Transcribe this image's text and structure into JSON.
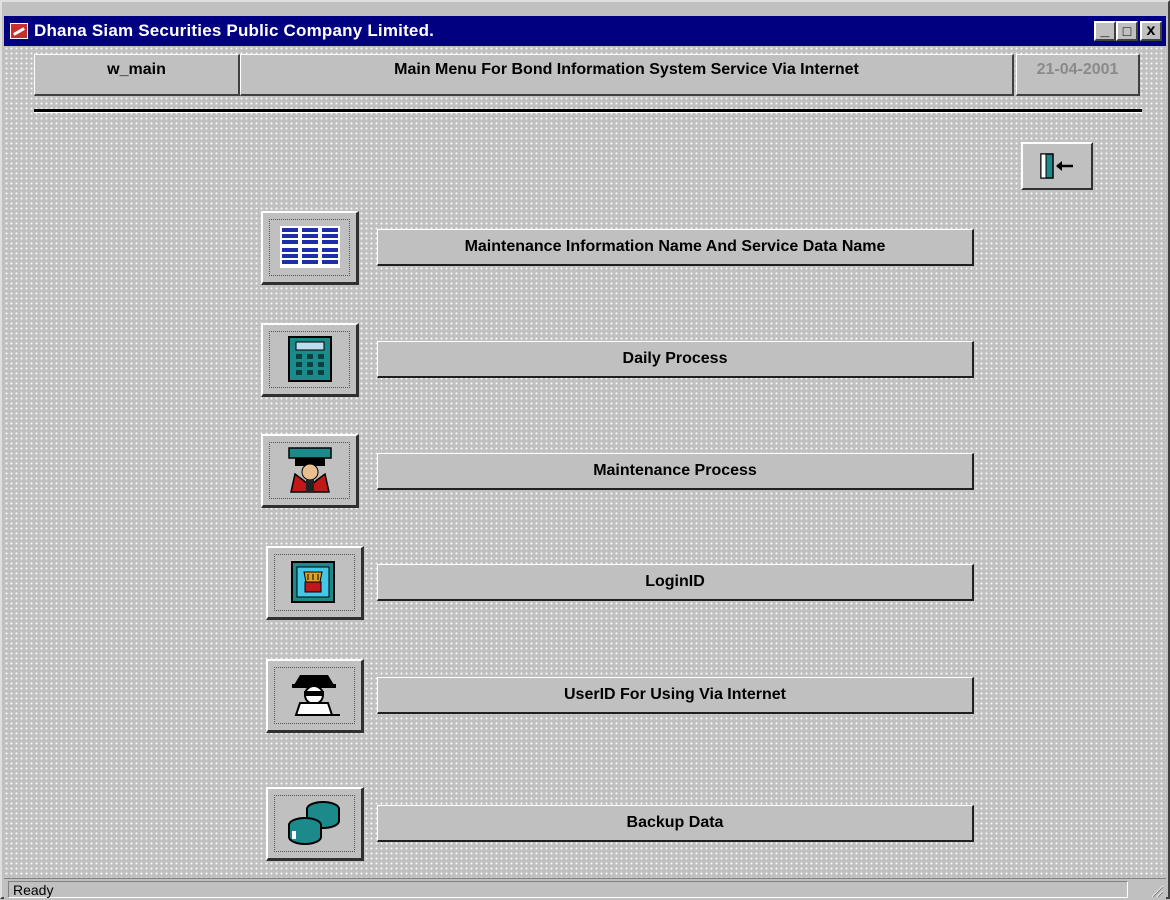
{
  "window": {
    "title": "Dhana Siam Securities Public Company Limited.",
    "app_icon": "app-icon",
    "controls": {
      "minimize": "_",
      "maximize": "□",
      "close": "x"
    }
  },
  "header": {
    "window_name": "w_main",
    "title": "Main Menu For Bond Information System Service Via Internet",
    "date": "21-04-2001"
  },
  "toolbar": {
    "exit_icon": "exit-door-icon"
  },
  "menu": [
    {
      "label": "Maintenance Information Name And Service Data Name",
      "icon": "grid-list-icon"
    },
    {
      "label": "Daily Process",
      "icon": "calculator-icon"
    },
    {
      "label": "Maintenance Process",
      "icon": "maintenance-worker-icon"
    },
    {
      "label": "LoginID",
      "icon": "login-screen-icon"
    },
    {
      "label": "UserID For Using Via Internet",
      "icon": "user-spy-icon"
    },
    {
      "label": "Backup Data",
      "icon": "database-backup-icon"
    }
  ],
  "status": {
    "text": "Ready"
  },
  "colors": {
    "titlebar": "#000080",
    "face": "#c0c0c0",
    "icon_blue": "#1c2fa8",
    "icon_teal": "#1c8a8a",
    "icon_red": "#c01818"
  }
}
